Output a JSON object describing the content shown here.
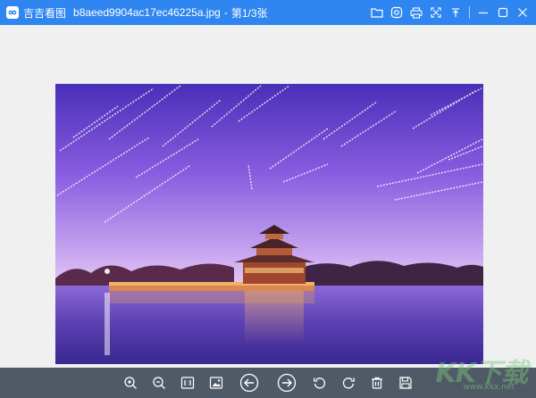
{
  "titlebar": {
    "app_name": "吉吉看图",
    "file_name": "b8aeed9904ac17ec46225a.jpg",
    "separator": "-",
    "page_info": "第1/3张"
  },
  "titlebar_icons": [
    "folder-icon",
    "settings-icon",
    "print-icon",
    "fullscreen-icon",
    "pin-icon",
    "minimize-icon",
    "maximize-icon",
    "close-icon"
  ],
  "toolbar_icons": [
    "zoom-in-icon",
    "zoom-out-icon",
    "actual-size-icon",
    "fit-image-icon",
    "previous-icon",
    "next-icon",
    "rotate-left-icon",
    "rotate-right-icon",
    "delete-icon",
    "save-icon"
  ],
  "photo": {
    "subject": "",
    "sky_top": "#4a2fb8",
    "sky_mid": "#8a5ce0",
    "sky_horizon": "#c9a7f0"
  },
  "watermark": {
    "main": "KK下载",
    "sub": "www.kkx.net"
  },
  "colors": {
    "titlebar": "#2f86f0",
    "toolbar": "#505a66",
    "background": "#f0f0f0"
  }
}
